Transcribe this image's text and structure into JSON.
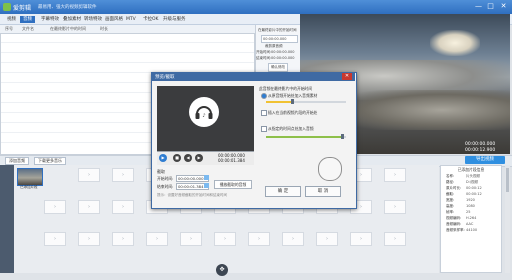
{
  "app": {
    "name": "爱剪辑",
    "title": "最易用、强大的视频剪辑软件"
  },
  "window_controls": [
    "—",
    "□",
    "✕"
  ],
  "menu": [
    "视频",
    "音频",
    "字幕特效",
    "叠加素材",
    "转场特效",
    "画面风格",
    "MTV",
    "卡拉OK",
    "升级与服务"
  ],
  "active_menu_index": 1,
  "table": {
    "headers": [
      "序号",
      "文件名",
      "在最终影片中的时间",
      "时长"
    ]
  },
  "side_panel": {
    "title": "在最终影片中的开始时间",
    "start_value": "00:00:00.000",
    "section_label": "裁剪原音频",
    "start_label": "开始时间:",
    "end_label": "结束时间:",
    "start_time": "00:00:00.000",
    "end_time": "00:00:00.000",
    "confirm_label": "确认修改"
  },
  "preview": {
    "time_current": "00:00:00.000",
    "time_total": "00:00:12.900"
  },
  "toolbar": {
    "add_audio": "添加音频",
    "download_music": "下载更多音乐",
    "export": "导出视频"
  },
  "timeline": {
    "clip_label": "已添加片段"
  },
  "info_panel": {
    "title": "已添加片段信息",
    "rows": [
      {
        "k": "名称:",
        "v": "片头视频"
      },
      {
        "k": "路径:",
        "v": "D:\\视频"
      },
      {
        "k": "原片时长:",
        "v": "00:00:12"
      },
      {
        "k": "截取:",
        "v": "00:00:12"
      },
      {
        "k": "宽度:",
        "v": "1920"
      },
      {
        "k": "高度:",
        "v": "1080"
      },
      {
        "k": "帧率:",
        "v": "25"
      },
      {
        "k": "视频编码:",
        "v": "H.264"
      },
      {
        "k": "音频编码:",
        "v": "AAC"
      },
      {
        "k": "音频采样率:",
        "v": "44100"
      }
    ]
  },
  "dialog": {
    "title": "预览/截取",
    "player_time_current": "00:00:00.000",
    "player_time_total": "00:00:01.384",
    "clip_section": "截取",
    "start_label": "开始时间:",
    "end_label": "结束时间:",
    "start_value": "00:00:00.000",
    "end_value": "00:00:01.384",
    "apply_label": "播放截取的音频",
    "hint": "提示：设置好音频截取的开始时间和结束时间",
    "options_title": "此音频在最终影片中的开始时间",
    "opt1": "从原音频开始处加入音频素材",
    "opt2": "插入在当前视频片段的开始处",
    "opt3": "从指定的时间点处加入音频",
    "ok": "确 定",
    "cancel": "取 消"
  }
}
